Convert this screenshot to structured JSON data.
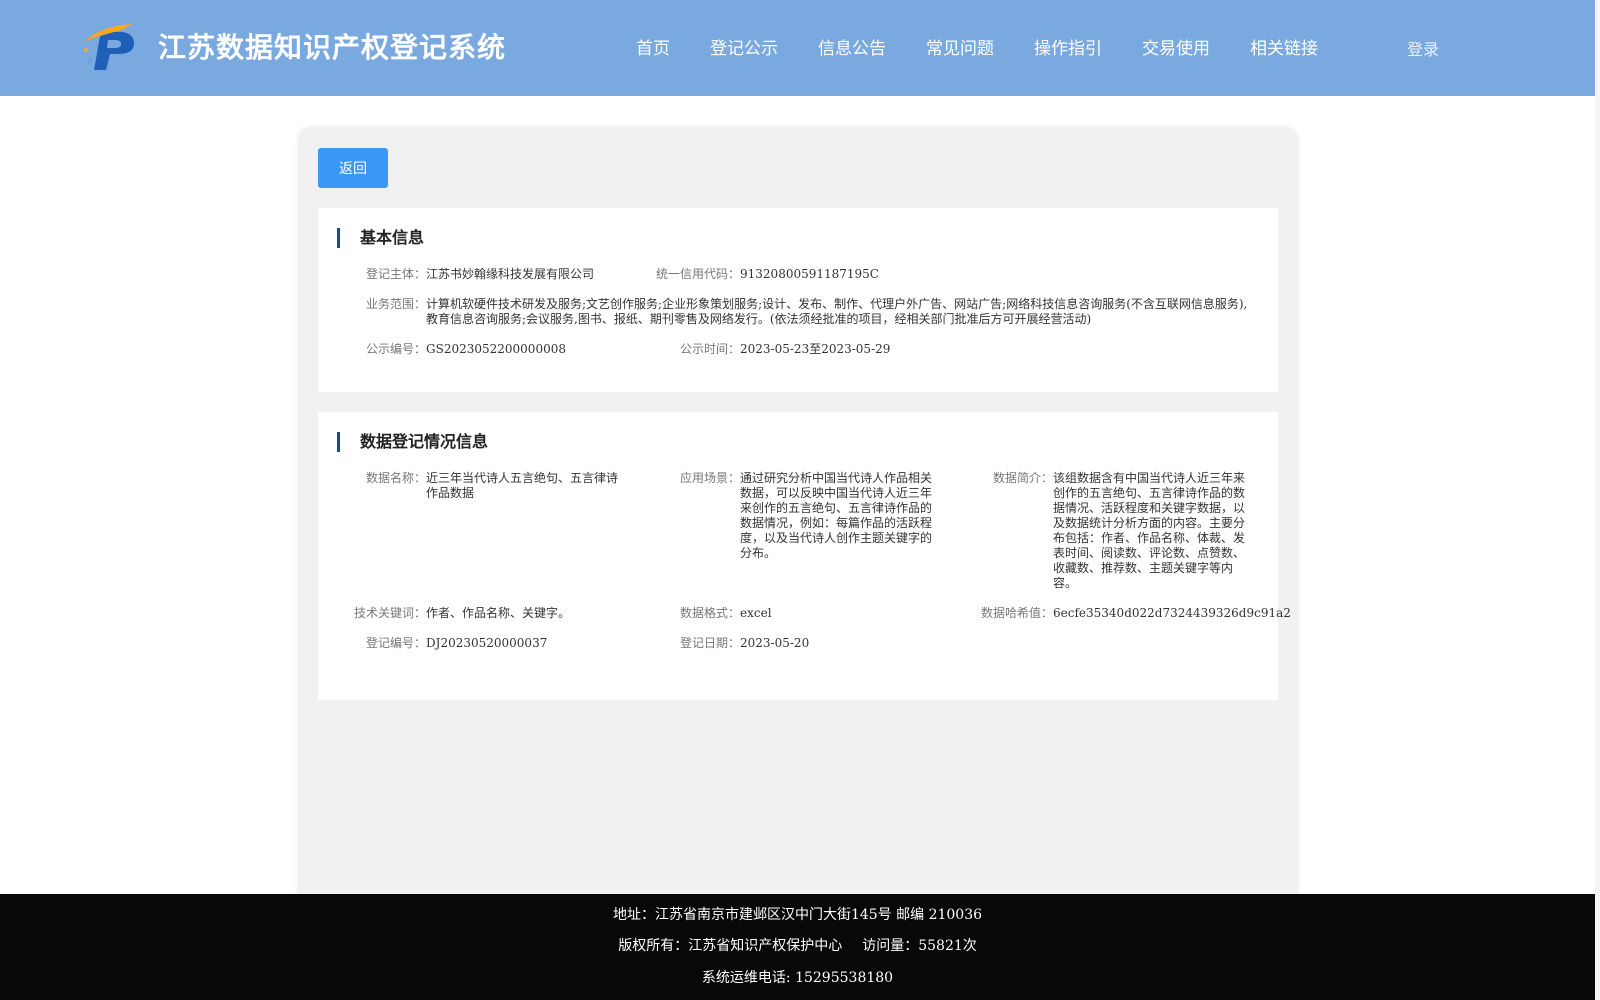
{
  "header": {
    "title": "江苏数据知识产权登记系统",
    "nav": [
      "首页",
      "登记公示",
      "信息公告",
      "常见问题",
      "操作指引",
      "交易使用",
      "相关链接"
    ],
    "login": "登录"
  },
  "back_button": "返回",
  "basic_info": {
    "title": "基本信息",
    "subject_label": "登记主体：",
    "subject": "江苏书妙翰缘科技发展有限公司",
    "credit_code_label": "统一信用代码：",
    "credit_code": "91320800591187195C",
    "scope_label": "业务范围：",
    "scope": "计算机软硬件技术研发及服务;文艺创作服务;企业形象策划服务;设计、发布、制作、代理户外广告、网站广告;网络科技信息咨询服务(不含互联网信息服务),教育信息咨询服务;会议服务,图书、报纸、期刊零售及网络发行。(依法须经批准的项目，经相关部门批准后方可开展经营活动)",
    "notice_no_label": "公示编号：",
    "notice_no": "GS2023052200000008",
    "notice_time_label": "公示时间：",
    "notice_time": "2023-05-23至2023-05-29"
  },
  "data_info": {
    "title": "数据登记情况信息",
    "name_label": "数据名称：",
    "name": "近三年当代诗人五言绝句、五言律诗作品数据",
    "scene_label": "应用场景：",
    "scene": "通过研究分析中国当代诗人作品相关数据，可以反映中国当代诗人近三年来创作的五言绝句、五言律诗作品的数据情况，例如：每篇作品的活跃程度，以及当代诗人创作主题关键字的分布。",
    "intro_label": "数据简介：",
    "intro": "该组数据含有中国当代诗人近三年来创作的五言绝句、五言律诗作品的数据情况、活跃程度和关键字数据，以及数据统计分析方面的内容。主要分布包括：作者、作品名称、体裁、发表时间、阅读数、评论数、点赞数、收藏数、推荐数、主题关键字等内容。",
    "keywords_label": "技术关键词：",
    "keywords": "作者、作品名称、关键字。",
    "format_label": "数据格式：",
    "format": "excel",
    "hash_label": "数据哈希值：",
    "hash": "6ecfe35340d022d7324439326d9c91a2",
    "reg_no_label": "登记编号：",
    "reg_no": "DJ20230520000037",
    "reg_date_label": "登记日期：",
    "reg_date": "2023-05-20"
  },
  "footer": {
    "address": "地址：江苏省南京市建邺区汉中门大街145号 邮编 210036",
    "copyright": "版权所有：江苏省知识产权保护中心",
    "visits": "访问量：55821次",
    "phone": "系统运维电话: 15295538180"
  },
  "colors": {
    "header_bg": "#7aa9df",
    "button_blue": "#3b97f5",
    "title_bar": "#0e4f9a",
    "footer_bg": "#080808"
  }
}
